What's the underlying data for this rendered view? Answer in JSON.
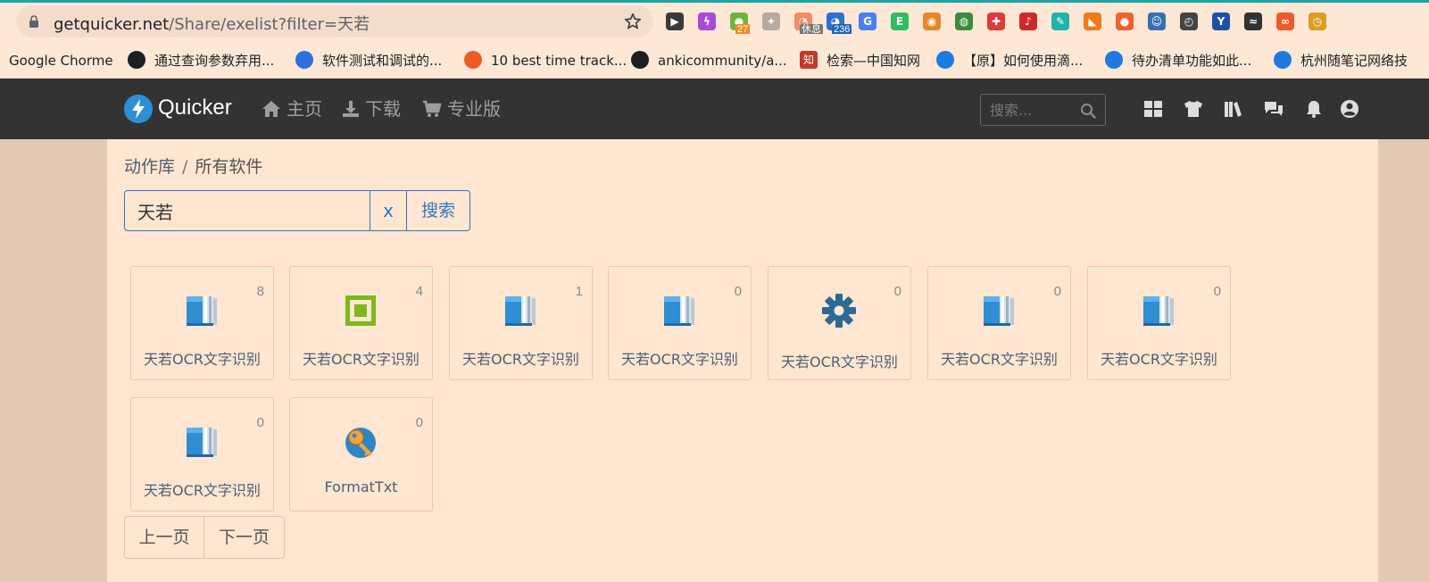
{
  "browser": {
    "url_host": "getquicker.net",
    "url_path": "/Share/exelist?filter=天若",
    "extensions": [
      {
        "name": "terminal-ext",
        "glyph": "▶",
        "color": "#3a3a3a"
      },
      {
        "name": "purple-ext",
        "glyph": "ϟ",
        "color": "#a64bd8"
      },
      {
        "name": "green-badge-ext",
        "glyph": "●",
        "color": "#6fb53a",
        "badge": "27",
        "badge_color": "#f08a24"
      },
      {
        "name": "pin-ext",
        "glyph": "✦",
        "color": "#b9a9a0"
      },
      {
        "name": "rest-ext",
        "glyph": "◔",
        "color": "#f28c6a",
        "badge": "休息",
        "badge_color": "#777"
      },
      {
        "name": "speed-ext",
        "glyph": "◕",
        "color": "#2f6fd0",
        "badge": "236",
        "badge_color": "#1f5fb8"
      },
      {
        "name": "translate-ext",
        "glyph": "G",
        "color": "#4a7ef0"
      },
      {
        "name": "evernote-ext",
        "glyph": "E",
        "color": "#2dbe60"
      },
      {
        "name": "colorful-ext",
        "glyph": "◉",
        "color": "#e6862e"
      },
      {
        "name": "globe-ext",
        "glyph": "◍",
        "color": "#3d8b3d"
      },
      {
        "name": "cross-ext",
        "glyph": "✚",
        "color": "#e03a3a"
      },
      {
        "name": "music-ext",
        "glyph": "♪",
        "color": "#d02828"
      },
      {
        "name": "pen-ext",
        "glyph": "✎",
        "color": "#1fb4a8"
      },
      {
        "name": "rss-ext",
        "glyph": "◣",
        "color": "#f07a1c"
      },
      {
        "name": "orange-ext",
        "glyph": "●",
        "color": "#f0622e"
      },
      {
        "name": "mascot-ext",
        "glyph": "☺",
        "color": "#3a6fb0"
      },
      {
        "name": "gauge-ext",
        "glyph": "◴",
        "color": "#444"
      },
      {
        "name": "y-ext",
        "glyph": "Y",
        "color": "#1f4fa8"
      },
      {
        "name": "en-ext",
        "glyph": "≈",
        "color": "#333"
      },
      {
        "name": "infinity-ext",
        "glyph": "∞",
        "color": "#f05a28"
      },
      {
        "name": "clock-ext",
        "glyph": "◷",
        "color": "#d8a020"
      }
    ],
    "bookmarks": [
      {
        "label": "Google Chorme",
        "icon": "",
        "color": ""
      },
      {
        "label": "通过查询参数弃用...",
        "icon": "github-icon",
        "color": "#1b1f23"
      },
      {
        "label": "软件测试和调试的...",
        "icon": "baidu-paw-icon",
        "color": "#2f6fe0"
      },
      {
        "label": "10 best time track...",
        "icon": "sunburst-icon",
        "color": "#f05a22"
      },
      {
        "label": "ankicommunity/a...",
        "icon": "github-icon",
        "color": "#1b1f23"
      },
      {
        "label": "检索—中国知网",
        "icon": "zhi-icon",
        "color": "#c0392b",
        "glyph": "知"
      },
      {
        "label": "【原】如何使用滴...",
        "icon": "edge-icon",
        "color": "#1f7ae0"
      },
      {
        "label": "待办清单功能如此...",
        "icon": "edge-icon",
        "color": "#1f7ae0"
      },
      {
        "label": "杭州随笔记网络技",
        "icon": "edge-icon",
        "color": "#1f7ae0"
      }
    ]
  },
  "navbar": {
    "brand": "Quicker",
    "links": [
      {
        "label": "主页",
        "icon": "home-icon"
      },
      {
        "label": "下载",
        "icon": "download-icon"
      },
      {
        "label": "专业版",
        "icon": "cart-icon"
      }
    ],
    "search_placeholder": "搜索...",
    "right_icons": [
      "grid-icon",
      "tshirt-icon",
      "library-icon",
      "chat-icon",
      "bell-icon",
      "user-icon"
    ]
  },
  "breadcrumb": {
    "root": "动作库",
    "separator": "/",
    "current": "所有软件"
  },
  "search": {
    "value": "天若",
    "clear_label": "x",
    "submit_label": "搜索"
  },
  "cards": [
    {
      "name": "天若OCR文字识别",
      "count": "8",
      "icon": "book-icon"
    },
    {
      "name": "天若OCR文字识别",
      "count": "4",
      "icon": "square-target-icon"
    },
    {
      "name": "天若OCR文字识别",
      "count": "1",
      "icon": "book-icon"
    },
    {
      "name": "天若OCR文字识别",
      "count": "0",
      "icon": "book-icon"
    },
    {
      "name": "天若OCR文字识别",
      "count": "0",
      "icon": "gear-icon"
    },
    {
      "name": "天若OCR文字识别",
      "count": "0",
      "icon": "book-icon"
    },
    {
      "name": "天若OCR文字识别",
      "count": "0",
      "icon": "book-icon"
    },
    {
      "name": "天若OCR文字识别",
      "count": "0",
      "icon": "book-icon"
    },
    {
      "name": "FormatTxt",
      "count": "0",
      "icon": "key-icon"
    }
  ],
  "pager": {
    "prev_label": "上一页",
    "next_label": "下一页"
  },
  "colors": {
    "navbar_bg": "#333333",
    "content_bg": "#ffe6d1",
    "accent": "#2f78bf",
    "link_text": "#4d6070"
  }
}
